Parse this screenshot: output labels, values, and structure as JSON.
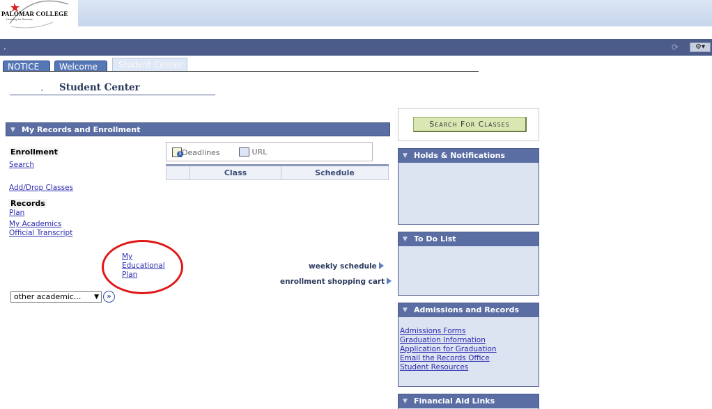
{
  "header": {
    "logo_text": "PALOMAR COLLEGE",
    "logo_tagline": "Learning for Success",
    "bar_text": "."
  },
  "tabs": [
    {
      "label": "NOTICE"
    },
    {
      "label": "Welcome"
    },
    {
      "label": "Student Center"
    }
  ],
  "page_title": "Student Center",
  "records": {
    "title": "My Records and Enrollment",
    "enrollment_label": "Enrollment",
    "search_link": "Search",
    "add_drop_link": "Add/Drop Classes",
    "records_label": "Records",
    "plan_link": "Plan",
    "my_academics_link": "My Academics",
    "transcript_link": "Official Transcript",
    "edu_plan_link": [
      "My",
      "Educational",
      "Plan"
    ],
    "deadlines": "Deadlines",
    "url": "URL",
    "table_headers": [
      "",
      "Class",
      "Schedule"
    ],
    "weekly_schedule": "weekly schedule",
    "shopping_cart": "enrollment shopping cart",
    "select_value": "other academic..."
  },
  "search_button": "Search For Classes",
  "holds": {
    "title": "Holds & Notifications"
  },
  "todo": {
    "title": "To Do List"
  },
  "admissions": {
    "title": "Admissions and Records",
    "links": [
      "Admissions Forms",
      "Graduation Information",
      "Application for Graduation",
      "Email the Records Office",
      "Student Resources"
    ]
  },
  "finaid": {
    "title": "Financial Aid Links"
  },
  "colors": {
    "section_header": "#5b6ea3",
    "highlight_circle": "#e01818",
    "search_button": "#d9e8b3"
  }
}
